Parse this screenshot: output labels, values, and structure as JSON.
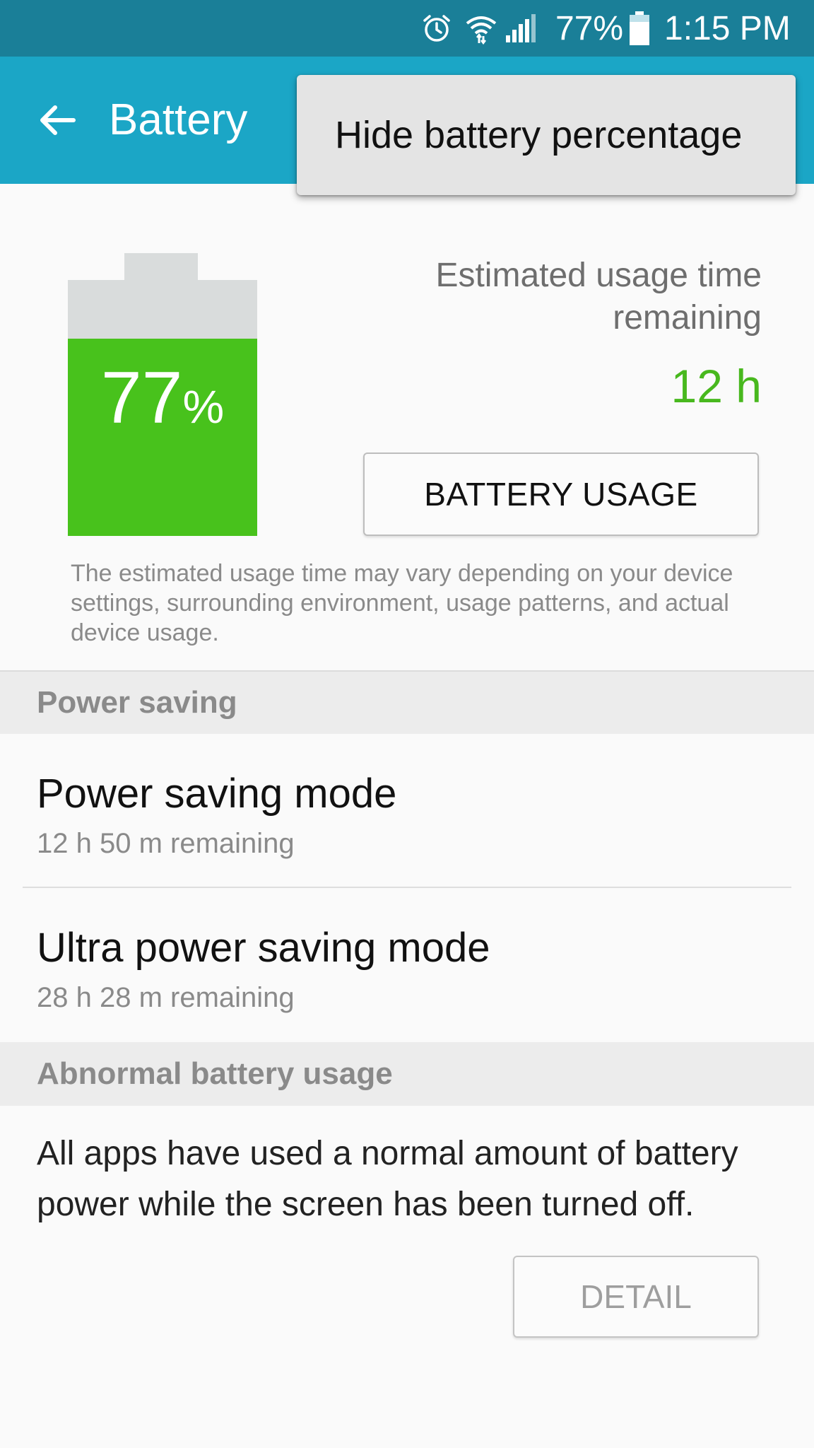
{
  "status_bar": {
    "battery_percent": "77%",
    "time": "1:15 PM",
    "icons": [
      "alarm-icon",
      "wifi-icon",
      "signal-icon",
      "battery-icon"
    ]
  },
  "app_bar": {
    "title": "Battery",
    "back_icon": "back-arrow-icon"
  },
  "popup_menu": {
    "items": [
      "Hide battery percentage"
    ]
  },
  "battery": {
    "level_number": "77",
    "level_sign": "%",
    "level_fraction": 0.77,
    "estimated_label": "Estimated usage time remaining",
    "estimated_value": "12 h",
    "usage_button": "BATTERY USAGE",
    "disclaimer": "The estimated usage time may vary depending on your device settings, surrounding environment, usage patterns, and actual device usage."
  },
  "power_saving": {
    "header": "Power saving",
    "items": [
      {
        "title": "Power saving mode",
        "subtitle": "12 h 50 m remaining"
      },
      {
        "title": "Ultra power saving mode",
        "subtitle": "28 h 28 m remaining"
      }
    ]
  },
  "abnormal": {
    "header": "Abnormal battery usage",
    "text": "All apps have used a normal amount of battery power while the screen has been turned off.",
    "detail_button": "DETAIL"
  },
  "colors": {
    "status_bar": "#1a7f98",
    "app_bar": "#1ba6c6",
    "battery_fill": "#48c21c",
    "battery_empty": "#d9dcdc",
    "accent_green": "#48b81e"
  }
}
